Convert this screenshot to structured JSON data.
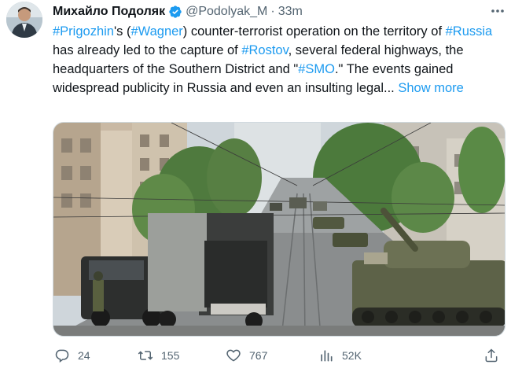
{
  "author": {
    "name": "Михайло Подоляк",
    "handle": "@Podolyak_M",
    "separator": "·",
    "time": "33m",
    "verified": true,
    "avatar_icon": "avatar-photo"
  },
  "tweet": {
    "segments": [
      {
        "text": "#Prigozhin",
        "link": true
      },
      {
        "text": "'s (",
        "link": false
      },
      {
        "text": "#Wagner",
        "link": true
      },
      {
        "text": ") counter-terrorist operation on the territory of ",
        "link": false
      },
      {
        "text": "#Russia",
        "link": true
      },
      {
        "text": " has already led to the capture of ",
        "link": false
      },
      {
        "text": "#Rostov",
        "link": true
      },
      {
        "text": ", several federal highways, the headquarters of the Southern District and \"",
        "link": false
      },
      {
        "text": "#SMO",
        "link": true
      },
      {
        "text": ".\" The events gained widespread publicity in Russia and even an insulting legal... ",
        "link": false
      }
    ],
    "show_more": "Show more"
  },
  "actions": {
    "replies": "24",
    "retweets": "155",
    "likes": "767",
    "views": "52K"
  },
  "colors": {
    "link": "#1d9bf0",
    "text": "#0f1419",
    "muted": "#536471",
    "verified": "#1d9bf0"
  },
  "icons": [
    "verified-badge-icon",
    "more-icon",
    "reply-icon",
    "retweet-icon",
    "like-icon",
    "views-icon",
    "share-icon"
  ]
}
